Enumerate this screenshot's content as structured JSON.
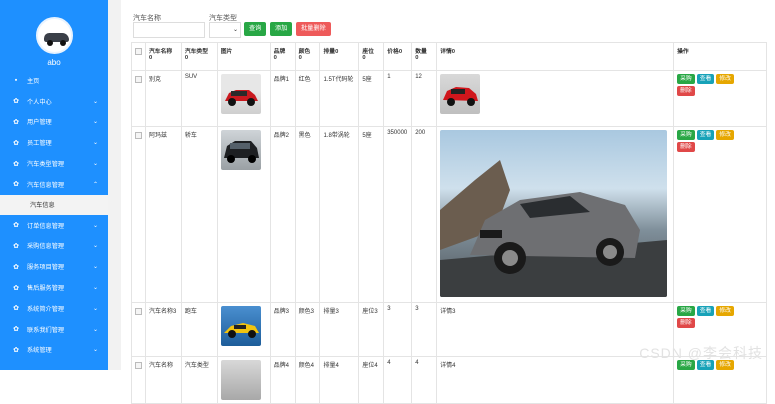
{
  "sidebar": {
    "username": "abo",
    "items": [
      {
        "label": "主页",
        "icon": "home-icon"
      },
      {
        "label": "个人中心",
        "icon": "gear-icon"
      },
      {
        "label": "用户管理",
        "icon": "gear-icon"
      },
      {
        "label": "员工管理",
        "icon": "gear-icon"
      },
      {
        "label": "汽车类型管理",
        "icon": "gear-icon"
      },
      {
        "label": "汽车信息管理",
        "icon": "gear-icon"
      },
      {
        "label": "订单信息管理",
        "icon": "gear-icon"
      },
      {
        "label": "采购信息管理",
        "icon": "gear-icon"
      },
      {
        "label": "服务项目管理",
        "icon": "gear-icon"
      },
      {
        "label": "售后服务管理",
        "icon": "gear-icon"
      },
      {
        "label": "系统简介管理",
        "icon": "gear-icon"
      },
      {
        "label": "联系我们管理",
        "icon": "gear-icon"
      },
      {
        "label": "系统管理",
        "icon": "gear-icon"
      }
    ],
    "submenu": "汽车信息"
  },
  "search": {
    "name_label": "汽车名称",
    "type_label": "汽车类型",
    "query_button": "查询",
    "add_button": "添加",
    "batch_delete_button": "批量删除"
  },
  "table": {
    "headers": [
      "汽车名称",
      "汽车类型",
      "图片",
      "品牌",
      "颜色",
      "排量",
      "座位",
      "价格",
      "数量",
      "详情",
      "操作"
    ],
    "sort_mark": "0",
    "rows": [
      {
        "name": "别克",
        "type": "SUV",
        "brand": "品牌1",
        "color": "红色",
        "displacement": "1.5T代码轮",
        "seats": "5座",
        "price": "1",
        "qty": "12",
        "detail": ""
      },
      {
        "name": "阿玛兹",
        "type": "轿车",
        "brand": "品牌2",
        "color": "黑色",
        "displacement": "1.8带涡轮",
        "seats": "5座",
        "price": "350000",
        "qty": "200",
        "detail": ""
      },
      {
        "name": "汽车名称3",
        "type": "跑车",
        "brand": "品牌3",
        "color": "颜色3",
        "displacement": "排量3",
        "seats": "座位3",
        "price": "3",
        "qty": "3",
        "detail": "详情3"
      },
      {
        "name": "汽车名称",
        "type": "汽车类型",
        "brand": "品牌4",
        "color": "颜色4",
        "displacement": "排量4",
        "seats": "座位4",
        "price": "4",
        "qty": "4",
        "detail": "详情4"
      }
    ],
    "actions": {
      "buy": "采购",
      "view": "查看",
      "edit": "修改",
      "delete": "删除"
    }
  },
  "watermark": "CSDN @李会科技",
  "colors": {
    "sidebar": "#1e90ff",
    "green": "#28a745",
    "teal": "#17a2b8",
    "yellow": "#e6a700",
    "red": "#e04848"
  }
}
